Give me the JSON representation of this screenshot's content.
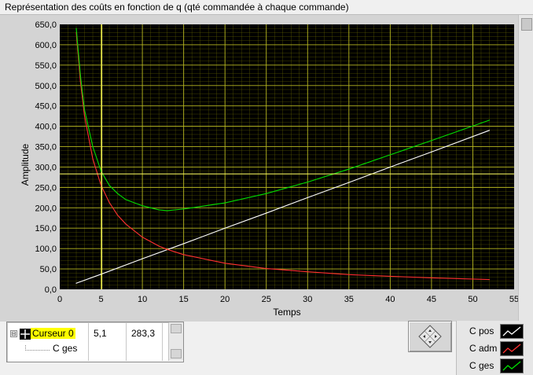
{
  "window_title": "Représentation des coûts en fonction de q (qté commandée à chaque commande)",
  "chart_data": {
    "type": "line",
    "xlabel": "Temps",
    "ylabel": "Amplitude",
    "xlim": [
      0,
      55
    ],
    "ylim": [
      0,
      650
    ],
    "x_ticks": [
      "0",
      "5",
      "10",
      "15",
      "20",
      "25",
      "30",
      "35",
      "40",
      "45",
      "50",
      "55"
    ],
    "y_ticks": [
      "0,0",
      "50,0",
      "100,0",
      "150,0",
      "200,0",
      "250,0",
      "300,0",
      "350,0",
      "400,0",
      "450,0",
      "500,0",
      "550,0",
      "600,0",
      "650,0"
    ],
    "grid": true,
    "plot_background": "#000000",
    "grid_color": "#7a7a00",
    "series": [
      {
        "name": "C pos",
        "color": "#ffffff",
        "x": [
          2,
          5,
          10,
          15,
          20,
          25,
          30,
          35,
          40,
          45,
          52
        ],
        "y": [
          15,
          37,
          75,
          112,
          150,
          187,
          225,
          262,
          300,
          337,
          390
        ]
      },
      {
        "name": "C adm",
        "color": "#ff3030",
        "x": [
          2,
          2.5,
          3,
          4,
          5,
          6,
          7,
          8,
          10,
          12,
          13,
          15,
          20,
          25,
          30,
          35,
          40,
          45,
          52
        ],
        "y": [
          630,
          510,
          425,
          320,
          255,
          213,
          182,
          160,
          128,
          106,
          98,
          85,
          64,
          51,
          43,
          36,
          32,
          28,
          24
        ]
      },
      {
        "name": "C ges",
        "color": "#00e000",
        "x": [
          2,
          2.5,
          3,
          4,
          5,
          6,
          7,
          8,
          10,
          12,
          13,
          15,
          20,
          25,
          30,
          35,
          40,
          45,
          52
        ],
        "y": [
          640,
          525,
          440,
          350,
          290,
          255,
          235,
          220,
          205,
          195,
          193,
          197,
          212,
          235,
          263,
          295,
          330,
          365,
          415
        ]
      }
    ],
    "cursor": {
      "name": "Curseur 0",
      "x": 5.1,
      "y": 283.3,
      "color": "#ffff66"
    }
  },
  "cursor_panel": {
    "expander": "⊟",
    "cursor_name": "Curseur 0",
    "x_value": "5,1",
    "y_value": "283,3",
    "plot_label": "C ges"
  },
  "legend": [
    {
      "label": "C pos",
      "color": "#ffffff"
    },
    {
      "label": "C adm",
      "color": "#ff3030"
    },
    {
      "label": "C ges",
      "color": "#00e000"
    }
  ],
  "icons": {
    "nav": "diamond-pan-icon"
  }
}
